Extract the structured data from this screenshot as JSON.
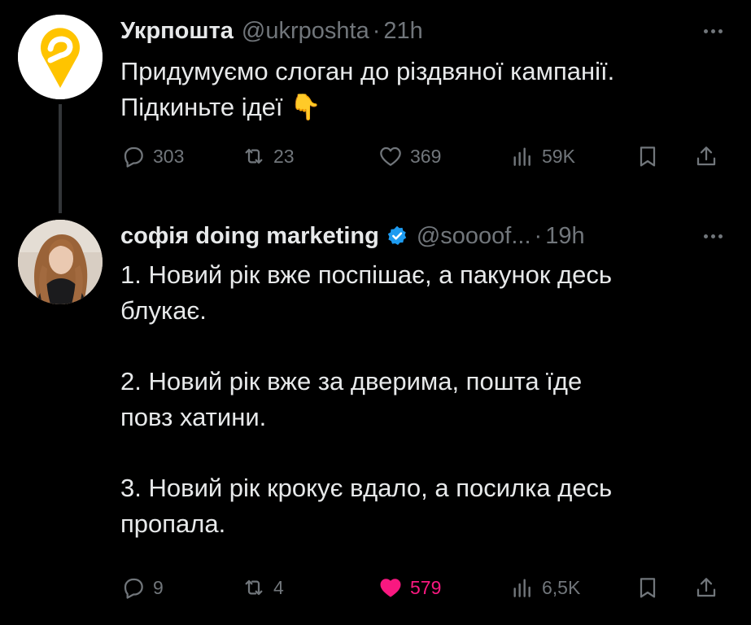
{
  "tweets": [
    {
      "author": {
        "name": "Укрпошта",
        "handle": "@ukrposhta",
        "time": "21h",
        "avatar": "ukrposhta-logo",
        "brand_color": "#ffc400"
      },
      "lines": [
        "Придумуємо слоган до різдвяної кампанії.",
        "Підкиньте ідеї 👇"
      ],
      "stats": {
        "replies": "303",
        "retweets": "23",
        "likes": "369",
        "views": "59K"
      }
    },
    {
      "author": {
        "name": "софія doing marketing",
        "handle": "@soooof...",
        "time": "19h",
        "verified": true,
        "verified_color": "#1d9bf0",
        "avatar": "profile-photo"
      },
      "paragraphs": [
        [
          "1. Новий рік вже поспішає, а пакунок десь",
          "блукає."
        ],
        [
          "2. Новий рік вже за дверима, пошта їде",
          "повз хатини."
        ],
        [
          "3. Новий рік крокує вдало, а посилка десь",
          "пропала."
        ]
      ],
      "stats": {
        "replies": "9",
        "retweets": "4",
        "likes": "579",
        "likes_active": true,
        "like_color": "#f91880",
        "views": "6,5K"
      }
    }
  ],
  "sep": "·",
  "icons": [
    "more-icon",
    "reply-icon",
    "retweet-icon",
    "like-icon",
    "views-icon",
    "bookmark-icon",
    "share-icon",
    "verified-badge-icon"
  ]
}
